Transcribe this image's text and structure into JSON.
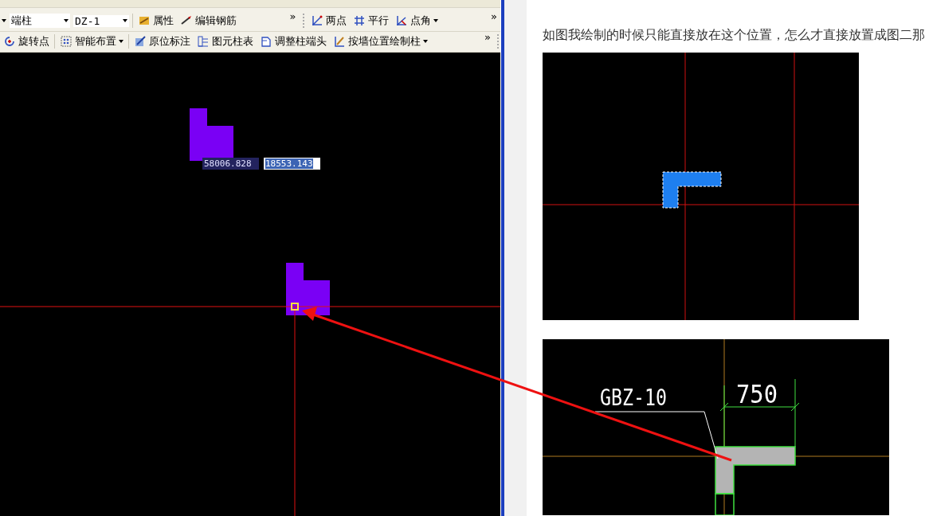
{
  "toolbar_1": {
    "selectors": [
      {
        "value": "端柱"
      },
      {
        "value": "DZ-1"
      }
    ],
    "buttons": [
      {
        "label": "属性"
      },
      {
        "label": "编辑钢筋"
      }
    ],
    "overflow": "»",
    "draw_buttons": [
      {
        "label": "两点"
      },
      {
        "label": "平行"
      },
      {
        "label": "点角",
        "dropdown": true
      }
    ],
    "overflow_2": "»"
  },
  "toolbar_2": {
    "buttons": [
      {
        "label": "旋转点"
      },
      {
        "label": "智能布置",
        "dropdown": true
      },
      {
        "label": "原位标注"
      },
      {
        "label": "图元柱表"
      },
      {
        "label": "调整柱端头"
      },
      {
        "label": "按墙位置绘制柱",
        "dropdown": true
      }
    ],
    "overflow": "»"
  },
  "canvas": {
    "coordinates": [
      {
        "value": "58006.828",
        "selected": false
      },
      {
        "value": "18553.143",
        "selected": true
      }
    ]
  },
  "post": {
    "body": "如图我绘制的时候只能直接放在这个位置，怎么才直接放置成图二那"
  },
  "figure_2": {
    "label": "GBZ-10",
    "dimension": "750"
  }
}
